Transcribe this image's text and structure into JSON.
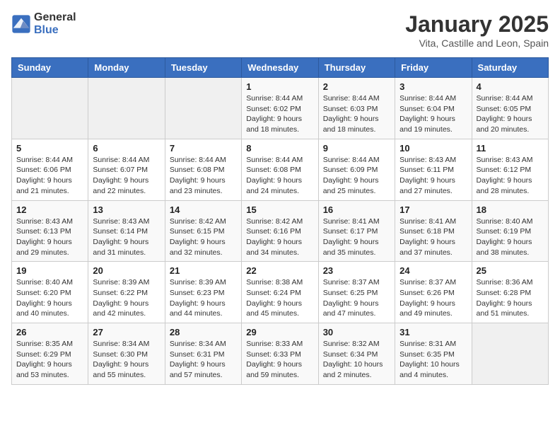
{
  "logo": {
    "line1": "General",
    "line2": "Blue"
  },
  "title": "January 2025",
  "subtitle": "Vita, Castille and Leon, Spain",
  "days_header": [
    "Sunday",
    "Monday",
    "Tuesday",
    "Wednesday",
    "Thursday",
    "Friday",
    "Saturday"
  ],
  "weeks": [
    [
      {
        "day": "",
        "sunrise": "",
        "sunset": "",
        "daylight": ""
      },
      {
        "day": "",
        "sunrise": "",
        "sunset": "",
        "daylight": ""
      },
      {
        "day": "",
        "sunrise": "",
        "sunset": "",
        "daylight": ""
      },
      {
        "day": "1",
        "sunrise": "Sunrise: 8:44 AM",
        "sunset": "Sunset: 6:02 PM",
        "daylight": "Daylight: 9 hours and 18 minutes."
      },
      {
        "day": "2",
        "sunrise": "Sunrise: 8:44 AM",
        "sunset": "Sunset: 6:03 PM",
        "daylight": "Daylight: 9 hours and 18 minutes."
      },
      {
        "day": "3",
        "sunrise": "Sunrise: 8:44 AM",
        "sunset": "Sunset: 6:04 PM",
        "daylight": "Daylight: 9 hours and 19 minutes."
      },
      {
        "day": "4",
        "sunrise": "Sunrise: 8:44 AM",
        "sunset": "Sunset: 6:05 PM",
        "daylight": "Daylight: 9 hours and 20 minutes."
      }
    ],
    [
      {
        "day": "5",
        "sunrise": "Sunrise: 8:44 AM",
        "sunset": "Sunset: 6:06 PM",
        "daylight": "Daylight: 9 hours and 21 minutes."
      },
      {
        "day": "6",
        "sunrise": "Sunrise: 8:44 AM",
        "sunset": "Sunset: 6:07 PM",
        "daylight": "Daylight: 9 hours and 22 minutes."
      },
      {
        "day": "7",
        "sunrise": "Sunrise: 8:44 AM",
        "sunset": "Sunset: 6:08 PM",
        "daylight": "Daylight: 9 hours and 23 minutes."
      },
      {
        "day": "8",
        "sunrise": "Sunrise: 8:44 AM",
        "sunset": "Sunset: 6:08 PM",
        "daylight": "Daylight: 9 hours and 24 minutes."
      },
      {
        "day": "9",
        "sunrise": "Sunrise: 8:44 AM",
        "sunset": "Sunset: 6:09 PM",
        "daylight": "Daylight: 9 hours and 25 minutes."
      },
      {
        "day": "10",
        "sunrise": "Sunrise: 8:43 AM",
        "sunset": "Sunset: 6:11 PM",
        "daylight": "Daylight: 9 hours and 27 minutes."
      },
      {
        "day": "11",
        "sunrise": "Sunrise: 8:43 AM",
        "sunset": "Sunset: 6:12 PM",
        "daylight": "Daylight: 9 hours and 28 minutes."
      }
    ],
    [
      {
        "day": "12",
        "sunrise": "Sunrise: 8:43 AM",
        "sunset": "Sunset: 6:13 PM",
        "daylight": "Daylight: 9 hours and 29 minutes."
      },
      {
        "day": "13",
        "sunrise": "Sunrise: 8:43 AM",
        "sunset": "Sunset: 6:14 PM",
        "daylight": "Daylight: 9 hours and 31 minutes."
      },
      {
        "day": "14",
        "sunrise": "Sunrise: 8:42 AM",
        "sunset": "Sunset: 6:15 PM",
        "daylight": "Daylight: 9 hours and 32 minutes."
      },
      {
        "day": "15",
        "sunrise": "Sunrise: 8:42 AM",
        "sunset": "Sunset: 6:16 PM",
        "daylight": "Daylight: 9 hours and 34 minutes."
      },
      {
        "day": "16",
        "sunrise": "Sunrise: 8:41 AM",
        "sunset": "Sunset: 6:17 PM",
        "daylight": "Daylight: 9 hours and 35 minutes."
      },
      {
        "day": "17",
        "sunrise": "Sunrise: 8:41 AM",
        "sunset": "Sunset: 6:18 PM",
        "daylight": "Daylight: 9 hours and 37 minutes."
      },
      {
        "day": "18",
        "sunrise": "Sunrise: 8:40 AM",
        "sunset": "Sunset: 6:19 PM",
        "daylight": "Daylight: 9 hours and 38 minutes."
      }
    ],
    [
      {
        "day": "19",
        "sunrise": "Sunrise: 8:40 AM",
        "sunset": "Sunset: 6:20 PM",
        "daylight": "Daylight: 9 hours and 40 minutes."
      },
      {
        "day": "20",
        "sunrise": "Sunrise: 8:39 AM",
        "sunset": "Sunset: 6:22 PM",
        "daylight": "Daylight: 9 hours and 42 minutes."
      },
      {
        "day": "21",
        "sunrise": "Sunrise: 8:39 AM",
        "sunset": "Sunset: 6:23 PM",
        "daylight": "Daylight: 9 hours and 44 minutes."
      },
      {
        "day": "22",
        "sunrise": "Sunrise: 8:38 AM",
        "sunset": "Sunset: 6:24 PM",
        "daylight": "Daylight: 9 hours and 45 minutes."
      },
      {
        "day": "23",
        "sunrise": "Sunrise: 8:37 AM",
        "sunset": "Sunset: 6:25 PM",
        "daylight": "Daylight: 9 hours and 47 minutes."
      },
      {
        "day": "24",
        "sunrise": "Sunrise: 8:37 AM",
        "sunset": "Sunset: 6:26 PM",
        "daylight": "Daylight: 9 hours and 49 minutes."
      },
      {
        "day": "25",
        "sunrise": "Sunrise: 8:36 AM",
        "sunset": "Sunset: 6:28 PM",
        "daylight": "Daylight: 9 hours and 51 minutes."
      }
    ],
    [
      {
        "day": "26",
        "sunrise": "Sunrise: 8:35 AM",
        "sunset": "Sunset: 6:29 PM",
        "daylight": "Daylight: 9 hours and 53 minutes."
      },
      {
        "day": "27",
        "sunrise": "Sunrise: 8:34 AM",
        "sunset": "Sunset: 6:30 PM",
        "daylight": "Daylight: 9 hours and 55 minutes."
      },
      {
        "day": "28",
        "sunrise": "Sunrise: 8:34 AM",
        "sunset": "Sunset: 6:31 PM",
        "daylight": "Daylight: 9 hours and 57 minutes."
      },
      {
        "day": "29",
        "sunrise": "Sunrise: 8:33 AM",
        "sunset": "Sunset: 6:33 PM",
        "daylight": "Daylight: 9 hours and 59 minutes."
      },
      {
        "day": "30",
        "sunrise": "Sunrise: 8:32 AM",
        "sunset": "Sunset: 6:34 PM",
        "daylight": "Daylight: 10 hours and 2 minutes."
      },
      {
        "day": "31",
        "sunrise": "Sunrise: 8:31 AM",
        "sunset": "Sunset: 6:35 PM",
        "daylight": "Daylight: 10 hours and 4 minutes."
      },
      {
        "day": "",
        "sunrise": "",
        "sunset": "",
        "daylight": ""
      }
    ]
  ]
}
